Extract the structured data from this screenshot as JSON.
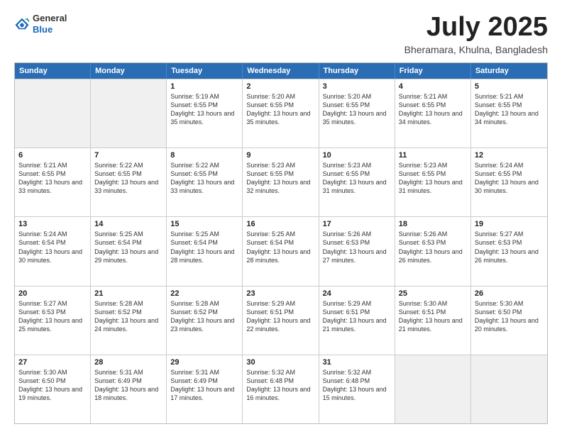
{
  "header": {
    "logo_general": "General",
    "logo_blue": "Blue",
    "month": "July 2025",
    "location": "Bheramara, Khulna, Bangladesh"
  },
  "days_of_week": [
    "Sunday",
    "Monday",
    "Tuesday",
    "Wednesday",
    "Thursday",
    "Friday",
    "Saturday"
  ],
  "weeks": [
    [
      {
        "day": "",
        "info": ""
      },
      {
        "day": "",
        "info": ""
      },
      {
        "day": "1",
        "info": "Sunrise: 5:19 AM\nSunset: 6:55 PM\nDaylight: 13 hours and 35 minutes."
      },
      {
        "day": "2",
        "info": "Sunrise: 5:20 AM\nSunset: 6:55 PM\nDaylight: 13 hours and 35 minutes."
      },
      {
        "day": "3",
        "info": "Sunrise: 5:20 AM\nSunset: 6:55 PM\nDaylight: 13 hours and 35 minutes."
      },
      {
        "day": "4",
        "info": "Sunrise: 5:21 AM\nSunset: 6:55 PM\nDaylight: 13 hours and 34 minutes."
      },
      {
        "day": "5",
        "info": "Sunrise: 5:21 AM\nSunset: 6:55 PM\nDaylight: 13 hours and 34 minutes."
      }
    ],
    [
      {
        "day": "6",
        "info": "Sunrise: 5:21 AM\nSunset: 6:55 PM\nDaylight: 13 hours and 33 minutes."
      },
      {
        "day": "7",
        "info": "Sunrise: 5:22 AM\nSunset: 6:55 PM\nDaylight: 13 hours and 33 minutes."
      },
      {
        "day": "8",
        "info": "Sunrise: 5:22 AM\nSunset: 6:55 PM\nDaylight: 13 hours and 33 minutes."
      },
      {
        "day": "9",
        "info": "Sunrise: 5:23 AM\nSunset: 6:55 PM\nDaylight: 13 hours and 32 minutes."
      },
      {
        "day": "10",
        "info": "Sunrise: 5:23 AM\nSunset: 6:55 PM\nDaylight: 13 hours and 31 minutes."
      },
      {
        "day": "11",
        "info": "Sunrise: 5:23 AM\nSunset: 6:55 PM\nDaylight: 13 hours and 31 minutes."
      },
      {
        "day": "12",
        "info": "Sunrise: 5:24 AM\nSunset: 6:55 PM\nDaylight: 13 hours and 30 minutes."
      }
    ],
    [
      {
        "day": "13",
        "info": "Sunrise: 5:24 AM\nSunset: 6:54 PM\nDaylight: 13 hours and 30 minutes."
      },
      {
        "day": "14",
        "info": "Sunrise: 5:25 AM\nSunset: 6:54 PM\nDaylight: 13 hours and 29 minutes."
      },
      {
        "day": "15",
        "info": "Sunrise: 5:25 AM\nSunset: 6:54 PM\nDaylight: 13 hours and 28 minutes."
      },
      {
        "day": "16",
        "info": "Sunrise: 5:25 AM\nSunset: 6:54 PM\nDaylight: 13 hours and 28 minutes."
      },
      {
        "day": "17",
        "info": "Sunrise: 5:26 AM\nSunset: 6:53 PM\nDaylight: 13 hours and 27 minutes."
      },
      {
        "day": "18",
        "info": "Sunrise: 5:26 AM\nSunset: 6:53 PM\nDaylight: 13 hours and 26 minutes."
      },
      {
        "day": "19",
        "info": "Sunrise: 5:27 AM\nSunset: 6:53 PM\nDaylight: 13 hours and 26 minutes."
      }
    ],
    [
      {
        "day": "20",
        "info": "Sunrise: 5:27 AM\nSunset: 6:53 PM\nDaylight: 13 hours and 25 minutes."
      },
      {
        "day": "21",
        "info": "Sunrise: 5:28 AM\nSunset: 6:52 PM\nDaylight: 13 hours and 24 minutes."
      },
      {
        "day": "22",
        "info": "Sunrise: 5:28 AM\nSunset: 6:52 PM\nDaylight: 13 hours and 23 minutes."
      },
      {
        "day": "23",
        "info": "Sunrise: 5:29 AM\nSunset: 6:51 PM\nDaylight: 13 hours and 22 minutes."
      },
      {
        "day": "24",
        "info": "Sunrise: 5:29 AM\nSunset: 6:51 PM\nDaylight: 13 hours and 21 minutes."
      },
      {
        "day": "25",
        "info": "Sunrise: 5:30 AM\nSunset: 6:51 PM\nDaylight: 13 hours and 21 minutes."
      },
      {
        "day": "26",
        "info": "Sunrise: 5:30 AM\nSunset: 6:50 PM\nDaylight: 13 hours and 20 minutes."
      }
    ],
    [
      {
        "day": "27",
        "info": "Sunrise: 5:30 AM\nSunset: 6:50 PM\nDaylight: 13 hours and 19 minutes."
      },
      {
        "day": "28",
        "info": "Sunrise: 5:31 AM\nSunset: 6:49 PM\nDaylight: 13 hours and 18 minutes."
      },
      {
        "day": "29",
        "info": "Sunrise: 5:31 AM\nSunset: 6:49 PM\nDaylight: 13 hours and 17 minutes."
      },
      {
        "day": "30",
        "info": "Sunrise: 5:32 AM\nSunset: 6:48 PM\nDaylight: 13 hours and 16 minutes."
      },
      {
        "day": "31",
        "info": "Sunrise: 5:32 AM\nSunset: 6:48 PM\nDaylight: 13 hours and 15 minutes."
      },
      {
        "day": "",
        "info": ""
      },
      {
        "day": "",
        "info": ""
      }
    ]
  ]
}
